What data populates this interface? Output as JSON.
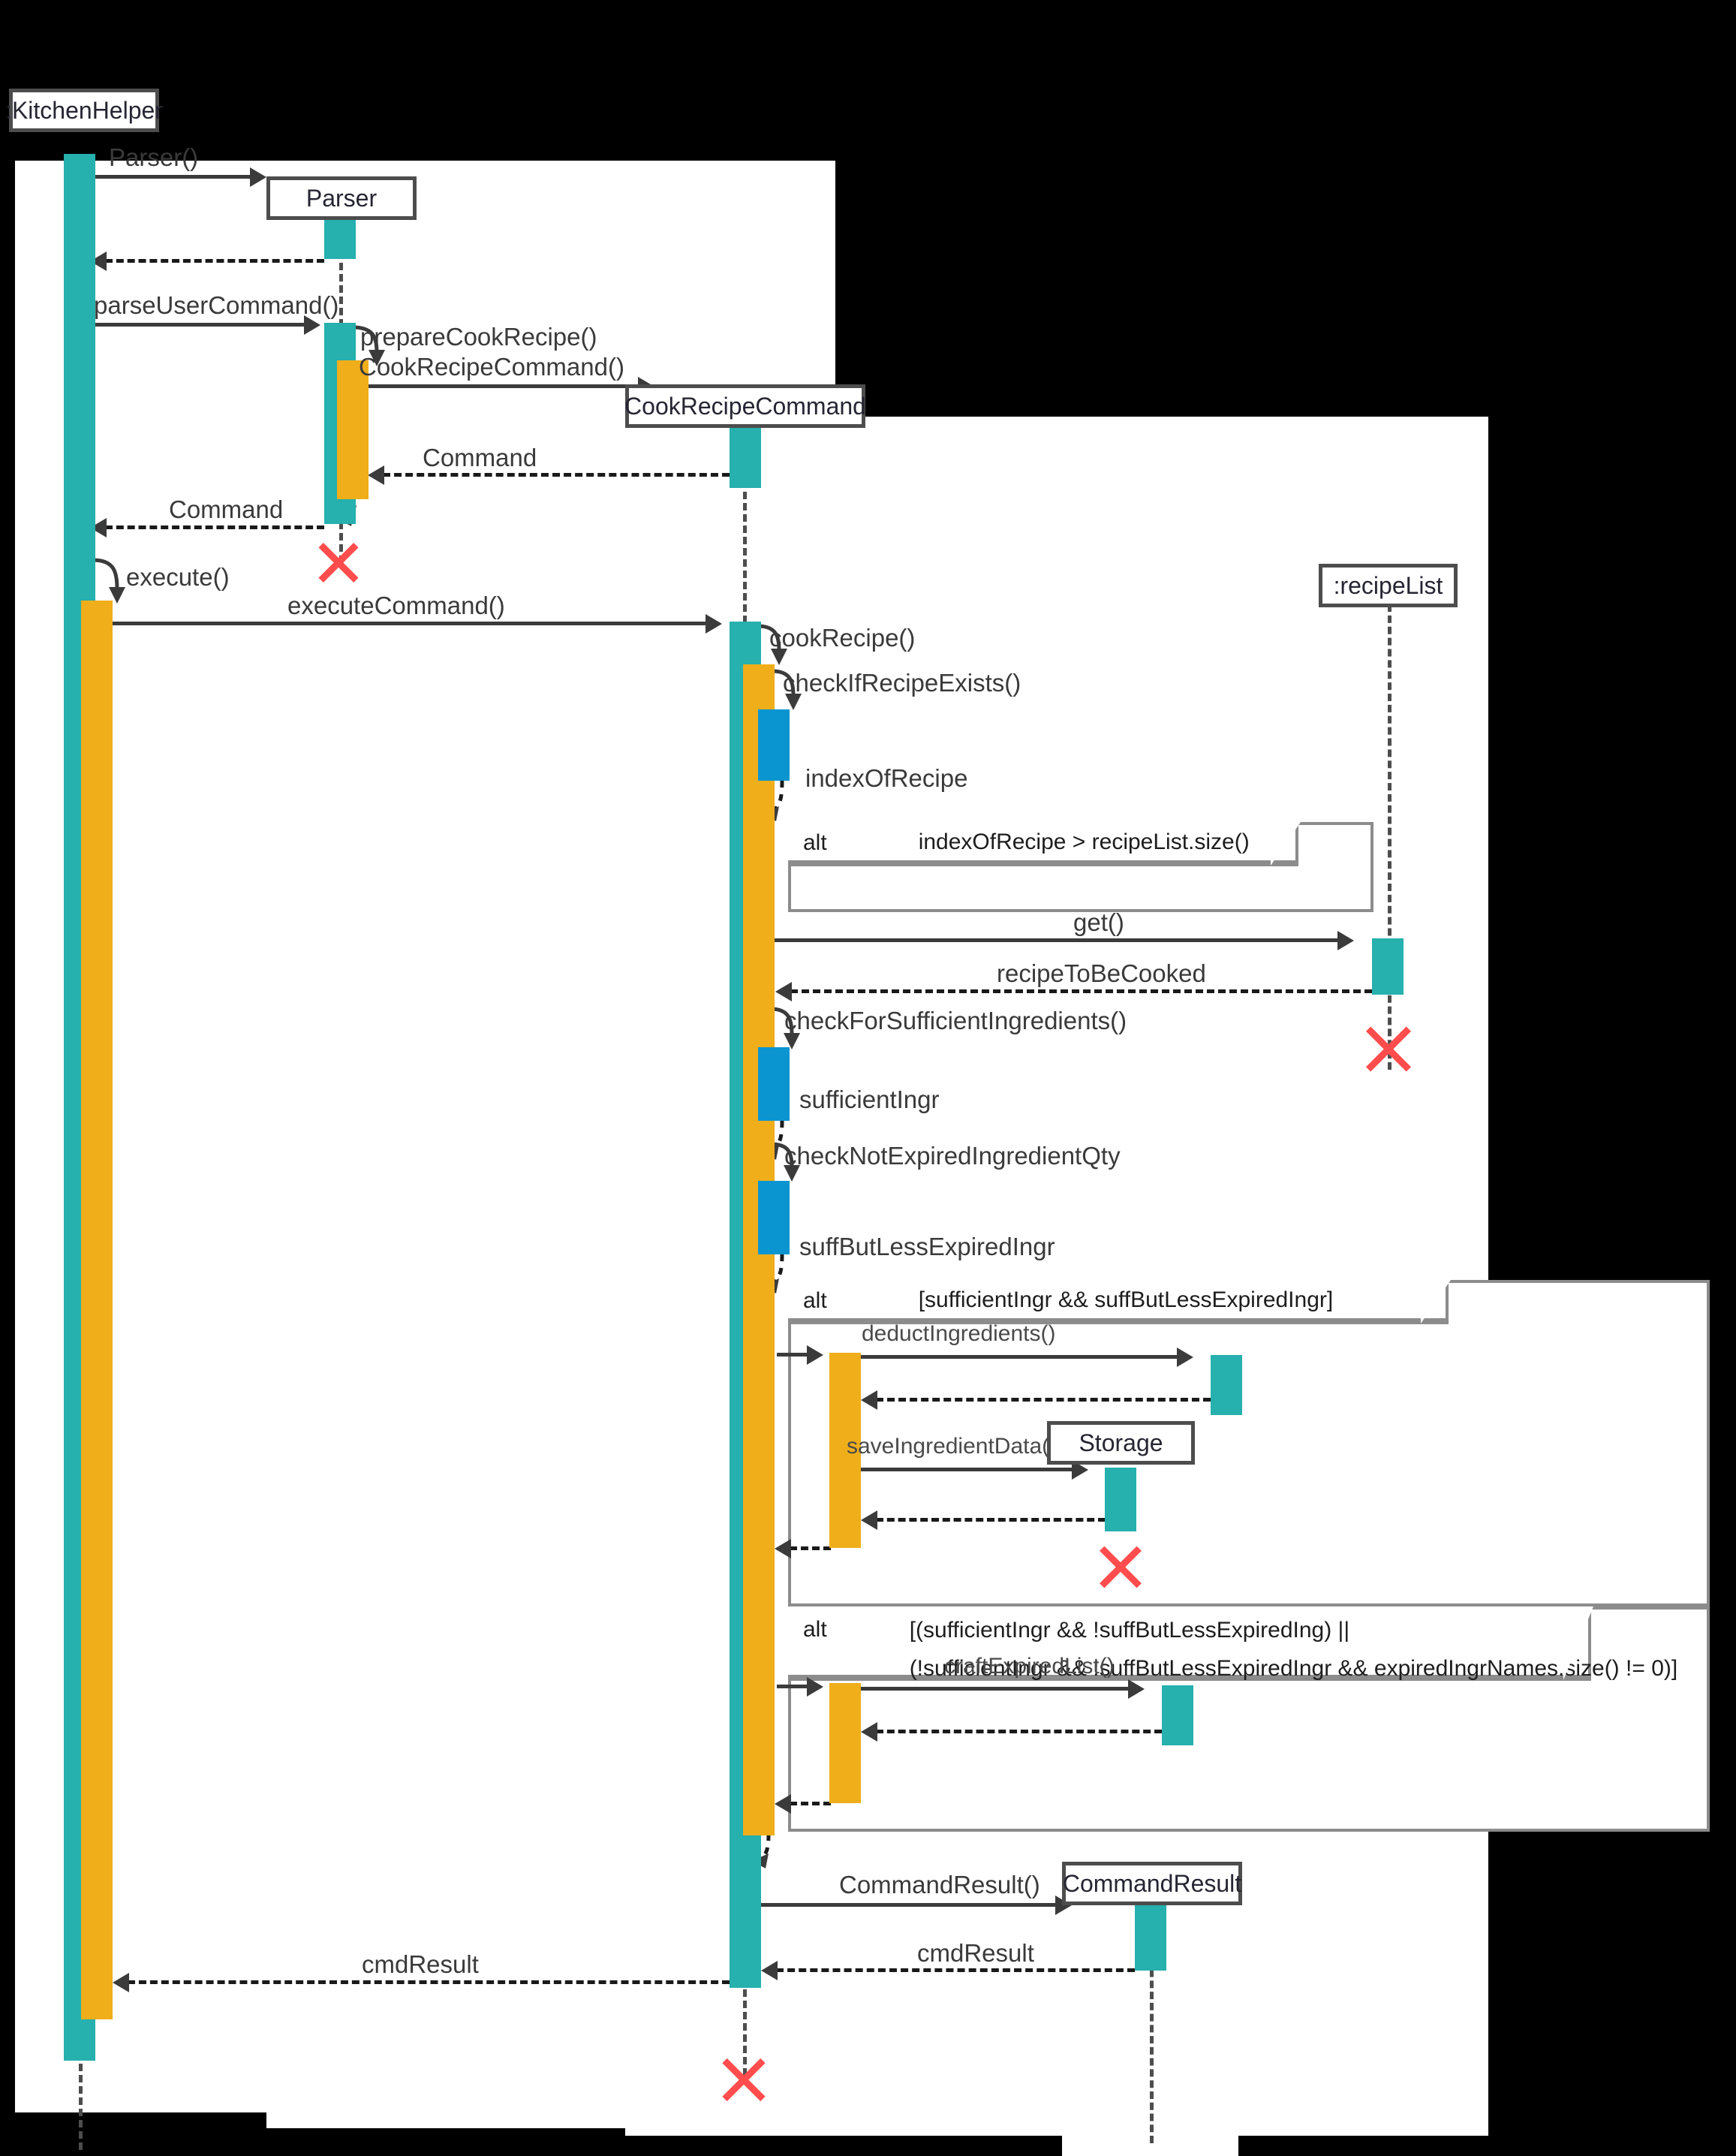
{
  "diagram": {
    "type": "uml-sequence-diagram",
    "title": "CookRecipe sequence diagram",
    "colors": {
      "activation_teal": "#26b0ae",
      "activation_orange": "#efae1a",
      "activation_blue": "#0b95d0",
      "destroy_marker": "#ff4d4d",
      "frame_border": "#8c8c8c",
      "lifeline": "#4d4d4d"
    }
  },
  "participants": [
    {
      "id": "kitchenhelper",
      "label": ":KitchenHelper"
    },
    {
      "id": "parser",
      "label": "Parser"
    },
    {
      "id": "cookrecipecommand",
      "label": "CookRecipeCommand"
    },
    {
      "id": "recipelist",
      "label": ":recipeList"
    },
    {
      "id": "storage",
      "label": "Storage"
    },
    {
      "id": "commandresult",
      "label": "CommandResult"
    }
  ],
  "messages": [
    {
      "id": "m01",
      "label": "Parser()"
    },
    {
      "id": "m02",
      "label": "parseUserCommand()"
    },
    {
      "id": "m03",
      "label": "prepareCookRecipe()"
    },
    {
      "id": "m04",
      "label": "CookRecipeCommand()"
    },
    {
      "id": "m05",
      "label": "Command"
    },
    {
      "id": "m06",
      "label": "Command"
    },
    {
      "id": "m07",
      "label": "execute()"
    },
    {
      "id": "m08",
      "label": "executeCommand()"
    },
    {
      "id": "m09",
      "label": "cookRecipe()"
    },
    {
      "id": "m10",
      "label": "checkIfRecipeExists()"
    },
    {
      "id": "m11",
      "label": "indexOfRecipe"
    },
    {
      "id": "m12",
      "label": "get()"
    },
    {
      "id": "m13",
      "label": "recipeToBeCooked"
    },
    {
      "id": "m14",
      "label": "checkForSufficientIngredients()"
    },
    {
      "id": "m15",
      "label": "sufficientIngr"
    },
    {
      "id": "m16",
      "label": "checkNotExpiredIngredientQty"
    },
    {
      "id": "m17",
      "label": "suffButLessExpiredIngr"
    },
    {
      "id": "m18",
      "label": "deductIngredients()"
    },
    {
      "id": "m19",
      "label": "saveIngredientData()"
    },
    {
      "id": "m20",
      "label": "craftExpiredList()"
    },
    {
      "id": "m21",
      "label": "CommandResult()"
    },
    {
      "id": "m22",
      "label": "cmdResult"
    },
    {
      "id": "m23",
      "label": "cmdResult"
    }
  ],
  "fragments": [
    {
      "id": "alt1",
      "operator": "alt",
      "condition_lines": [
        "indexOfRecipe > recipeList.size()"
      ]
    },
    {
      "id": "alt2",
      "operator": "alt",
      "condition_lines": [
        "[sufficientIngr && suffButLessExpiredIngr]"
      ]
    },
    {
      "id": "alt3",
      "operator": "alt",
      "condition_lines": [
        "[(sufficientIngr && !suffButLessExpiredIng) ||",
        "(!sufficientIngr && !suffButLessExpiredIngr && expiredIngrNames.size() != 0)]"
      ]
    }
  ]
}
